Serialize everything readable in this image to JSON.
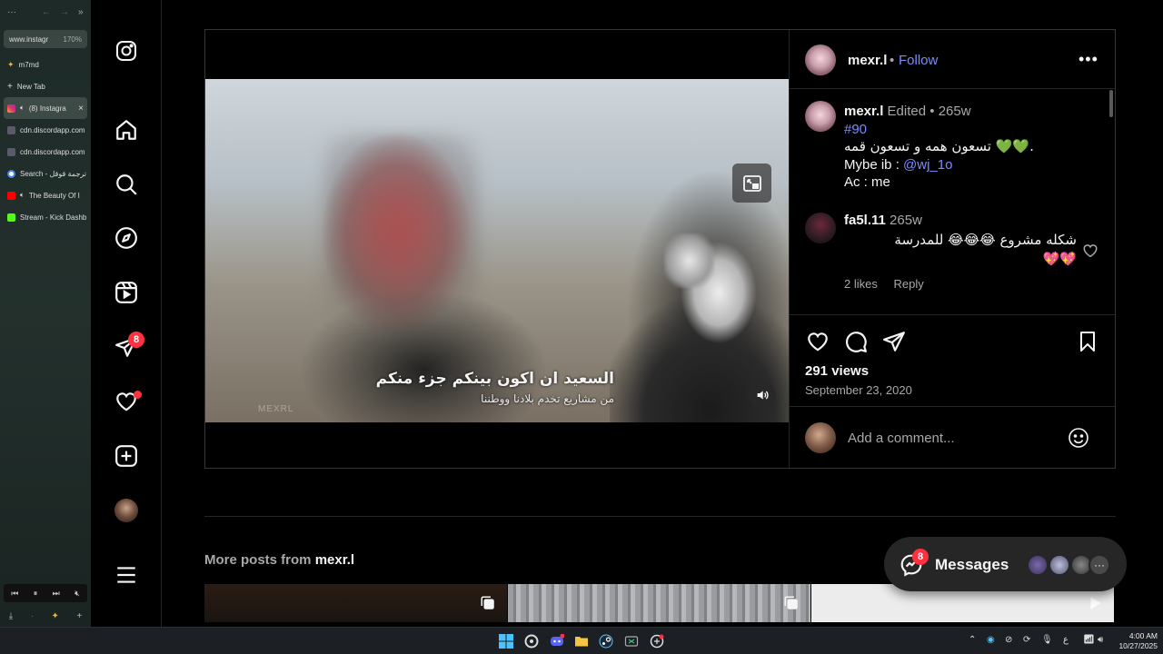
{
  "browser": {
    "url": "www.instagr",
    "zoom": "170%",
    "tabs": [
      {
        "label": "m7md",
        "favicon": "sparkle-icon",
        "color": "#f0b23a"
      },
      {
        "label": "New Tab",
        "favicon": "plus-icon",
        "color": "#bbbbbb"
      },
      {
        "label": "(8) Instagra",
        "favicon": "instagram-icon",
        "color": "#e1306c"
      },
      {
        "label": "cdn.discordapp.com",
        "favicon": "discord-icon",
        "color": "#5a5a6a"
      },
      {
        "label": "cdn.discordapp.com",
        "favicon": "discord-icon",
        "color": "#5a5a6a"
      },
      {
        "label": "Search - ترجمة قوقل",
        "favicon": "google-icon",
        "color": "#4285f4"
      },
      {
        "label": "The Beauty Of I",
        "favicon": "youtube-icon",
        "color": "#ff0000"
      },
      {
        "label": "Stream - Kick Dashb",
        "favicon": "kick-icon",
        "color": "#53fc18"
      }
    ]
  },
  "nav": {
    "messages_badge": "8"
  },
  "post": {
    "owner": "mexr.l",
    "dot": "•",
    "follow_label": "Follow",
    "more_label": "•••",
    "subtitle_line1": "السعيد ان اكون بينكم جزء منكم",
    "subtitle_line2": "من مشاريع تخدم بلادنا ووطننا",
    "watermark": "MEXRL",
    "caption": {
      "username": "mexr.l",
      "edited": "Edited",
      "dot": "•",
      "age": "265w",
      "hashtag": "#90",
      "line1": "تسعون همه و تسعون قمه 💚💚.",
      "line2_prefix": "Mybe ib : ",
      "line2_mention": "@wj_1o",
      "line3": "Ac : me"
    },
    "comment": {
      "username": "fa5l.11",
      "age": "265w",
      "text_line1": "شكله مشروع 😂😂😂 للمدرسة",
      "text_line2": "💖💖",
      "likes": "2 likes",
      "reply_label": "Reply"
    },
    "views": "291 views",
    "date": "September 23, 2020",
    "add_comment_placeholder": "Add a comment..."
  },
  "more_posts": {
    "prefix": "More posts from ",
    "username": "mexr.l"
  },
  "messages": {
    "label": "Messages",
    "badge": "8",
    "more_label": "···"
  },
  "clock": {
    "time": "4:00 AM",
    "date": "10/27/2025"
  },
  "tray": {
    "lang": "ع"
  },
  "colors": {
    "accent_link": "#7b8cff",
    "badge_red": "#ff3040",
    "background": "#000000",
    "border": "#262626"
  }
}
